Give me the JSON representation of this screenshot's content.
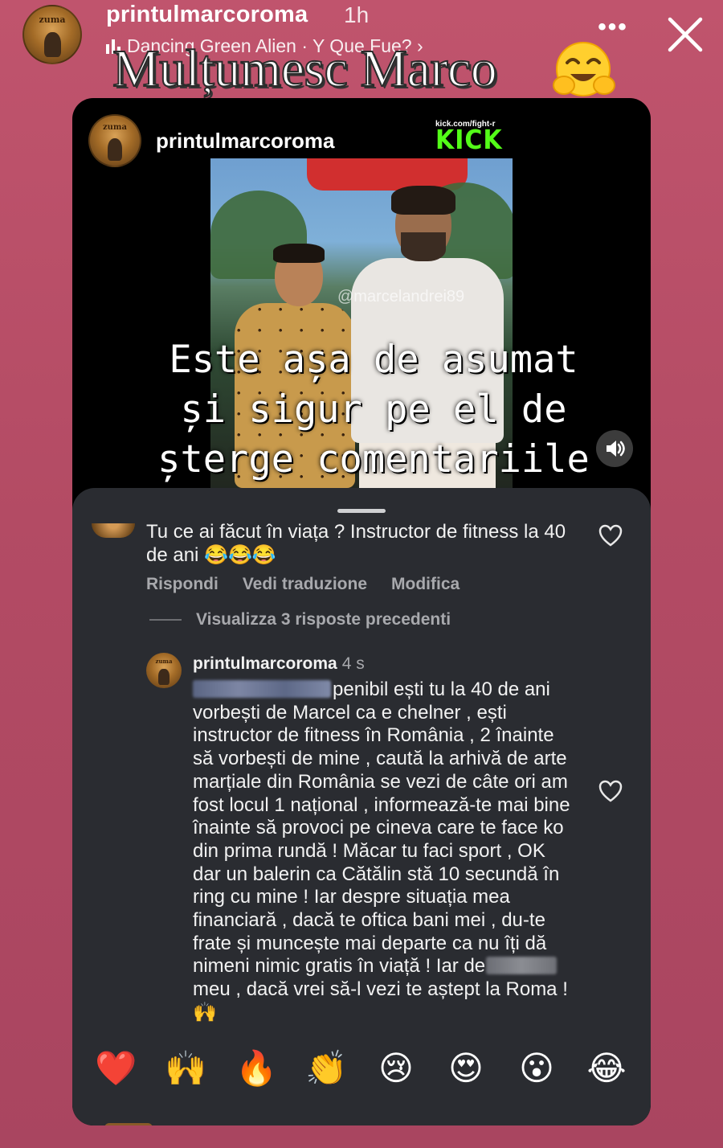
{
  "story": {
    "username": "printulmarcoroma",
    "time": "1h",
    "music": "Dancing Green Alien · Y Que Fue? ›",
    "avatar_text": "zuma",
    "more_icon": "more-horizontal-icon",
    "close_icon": "close-icon",
    "sticker_text": "Mulțumesc Marco",
    "sticker_emoji": "smiling-face-with-open-hands"
  },
  "post": {
    "username": "printulmarcoroma",
    "avatar_text": "zuma",
    "kick_url": "kick.com/fight-r",
    "kick_word": "KICK",
    "watermark": "@marcelandrei89",
    "caption_line1": "Este așa de asumat",
    "caption_line2": "și sigur pe el de",
    "caption_line3": "șterge comentariile",
    "sound_icon": "speaker-icon"
  },
  "comments": {
    "comment1": {
      "text": "Tu ce ai făcut în viața ? Instructor de fitness la 40 de ani 😂😂😂",
      "actions": [
        "Rispondi",
        "Vedi traduzione",
        "Modifica"
      ]
    },
    "view_replies": "Visualizza 3 risposte precedenti",
    "reply": {
      "username": "printulmarcoroma",
      "time": "4 s",
      "text_part1": "penibil ești tu la 40 de ani vorbești de Marcel ca e chelner , ești instructor de fitness în România , 2 înainte să vorbești de mine , caută la arhivă de arte marțiale din România se vezi de câte ori am fost locul 1 național , informează-te mai bine înainte să provoci pe cineva care te face ko din prima rundă ! Măcar tu faci sport , OK dar un balerin ca Cătălin stă 10 secundă în ring cu mine ! Iar despre situația mea financiară , dacă te oftica bani mei , du-te frate și muncește mai departe ca nu îți dă nimeni nimic gratis în viață ! Iar de",
      "text_part2": "meu , dacă vrei să-l vezi te aștept la Roma ! 🙌"
    }
  },
  "reactions": [
    "❤️",
    "🙌",
    "🔥",
    "👏",
    "😢",
    "😍",
    "😮",
    "😂"
  ]
}
